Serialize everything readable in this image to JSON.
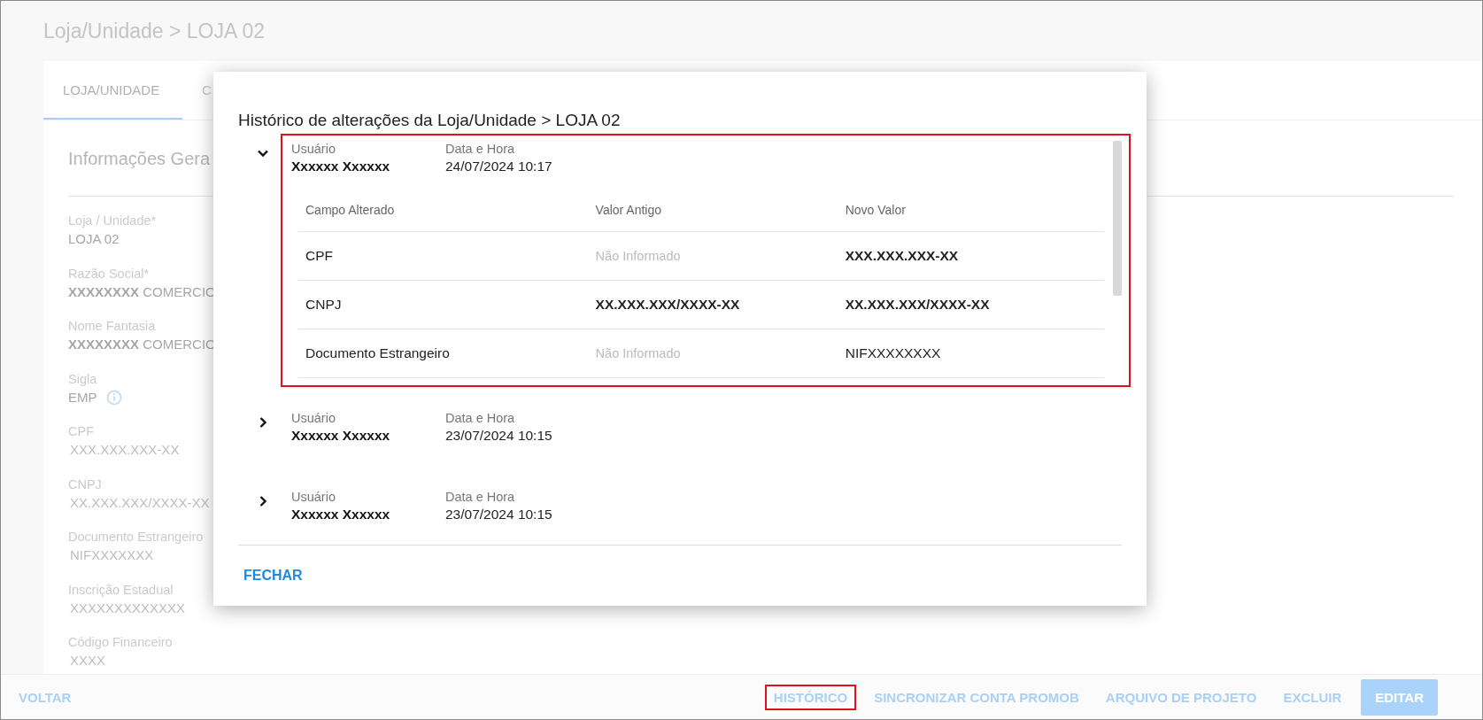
{
  "page": {
    "title": "Loja/Unidade > LOJA 02",
    "tabs": [
      {
        "label": "LOJA/UNIDADE",
        "selected": true
      },
      {
        "label": "C",
        "selected": false
      }
    ],
    "section_title": "Informações Gera",
    "fields": [
      {
        "label": "Loja / Unidade*",
        "value": "LOJA 02",
        "kind": "strong"
      },
      {
        "label": "Razão Social*",
        "value": "**XXXXXXXX** COMERCIO",
        "kind": "strong"
      },
      {
        "label": "Nome Fantasia",
        "value": "**XXXXXXXX** COMERCIO",
        "kind": "strong"
      },
      {
        "label": "Sigla",
        "value": "EMP",
        "kind": "strong",
        "info": true
      },
      {
        "label": "CPF",
        "value": "XXX.XXX.XXX-XX",
        "kind": "light"
      },
      {
        "label": "CNPJ",
        "value": "XX.XXX.XXX/XXXX-XX",
        "kind": "light"
      },
      {
        "label": "Documento Estrangeiro",
        "value": "NIFXXXXXXX",
        "kind": "light"
      },
      {
        "label": "Inscrição Estadual",
        "value": "XXXXXXXXXXXXX",
        "kind": "light"
      },
      {
        "label": "Código Financeiro",
        "value": "XXXX",
        "kind": "light"
      }
    ]
  },
  "modal": {
    "title": "Histórico de alterações da Loja/Unidade > LOJA 02",
    "entries": [
      {
        "expanded": true,
        "highlighted": true,
        "user_label": "Usuário",
        "user": "Xxxxxx Xxxxxx",
        "date_label": "Data e Hora",
        "date": "24/07/2024 10:17",
        "columns": [
          "Campo Alterado",
          "Valor Antigo",
          "Novo Valor"
        ],
        "rows": [
          {
            "cells": [
              {
                "text": "CPF",
                "kind": "plain"
              },
              {
                "text": "Não Informado",
                "kind": "muted"
              },
              {
                "text": "XXX.XXX.XXX-XX",
                "kind": "bold"
              }
            ]
          },
          {
            "cells": [
              {
                "text": "CNPJ",
                "kind": "plain"
              },
              {
                "text": "XX.XXX.XXX/XXXX-XX",
                "kind": "bold"
              },
              {
                "text": "XX.XXX.XXX/XXXX-XX",
                "kind": "bold"
              }
            ]
          },
          {
            "cells": [
              {
                "text": "Documento Estrangeiro",
                "kind": "plain"
              },
              {
                "text": "Não Informado",
                "kind": "muted"
              },
              {
                "text": "NIFXXXXXXXX",
                "kind": "plain"
              }
            ]
          }
        ]
      },
      {
        "expanded": false,
        "highlighted": false,
        "user_label": "Usuário",
        "user": "Xxxxxx Xxxxxx",
        "date_label": "Data e Hora",
        "date": "23/07/2024 10:15"
      },
      {
        "expanded": false,
        "highlighted": false,
        "user_label": "Usuário",
        "user": "Xxxxxx Xxxxxx",
        "date_label": "Data e Hora",
        "date": "23/07/2024 10:15"
      }
    ],
    "close_button": "FECHAR"
  },
  "footer": {
    "back": "VOLTAR",
    "actions": [
      {
        "label": "HISTÓRICO",
        "kind": "link",
        "highlighted": true
      },
      {
        "label": "SINCRONIZAR CONTA PROMOB",
        "kind": "link",
        "highlighted": false
      },
      {
        "label": "ARQUIVO DE PROJETO",
        "kind": "link",
        "highlighted": false
      },
      {
        "label": "EXCLUIR",
        "kind": "link",
        "highlighted": false
      },
      {
        "label": "EDITAR",
        "kind": "filled",
        "highlighted": false
      }
    ]
  }
}
